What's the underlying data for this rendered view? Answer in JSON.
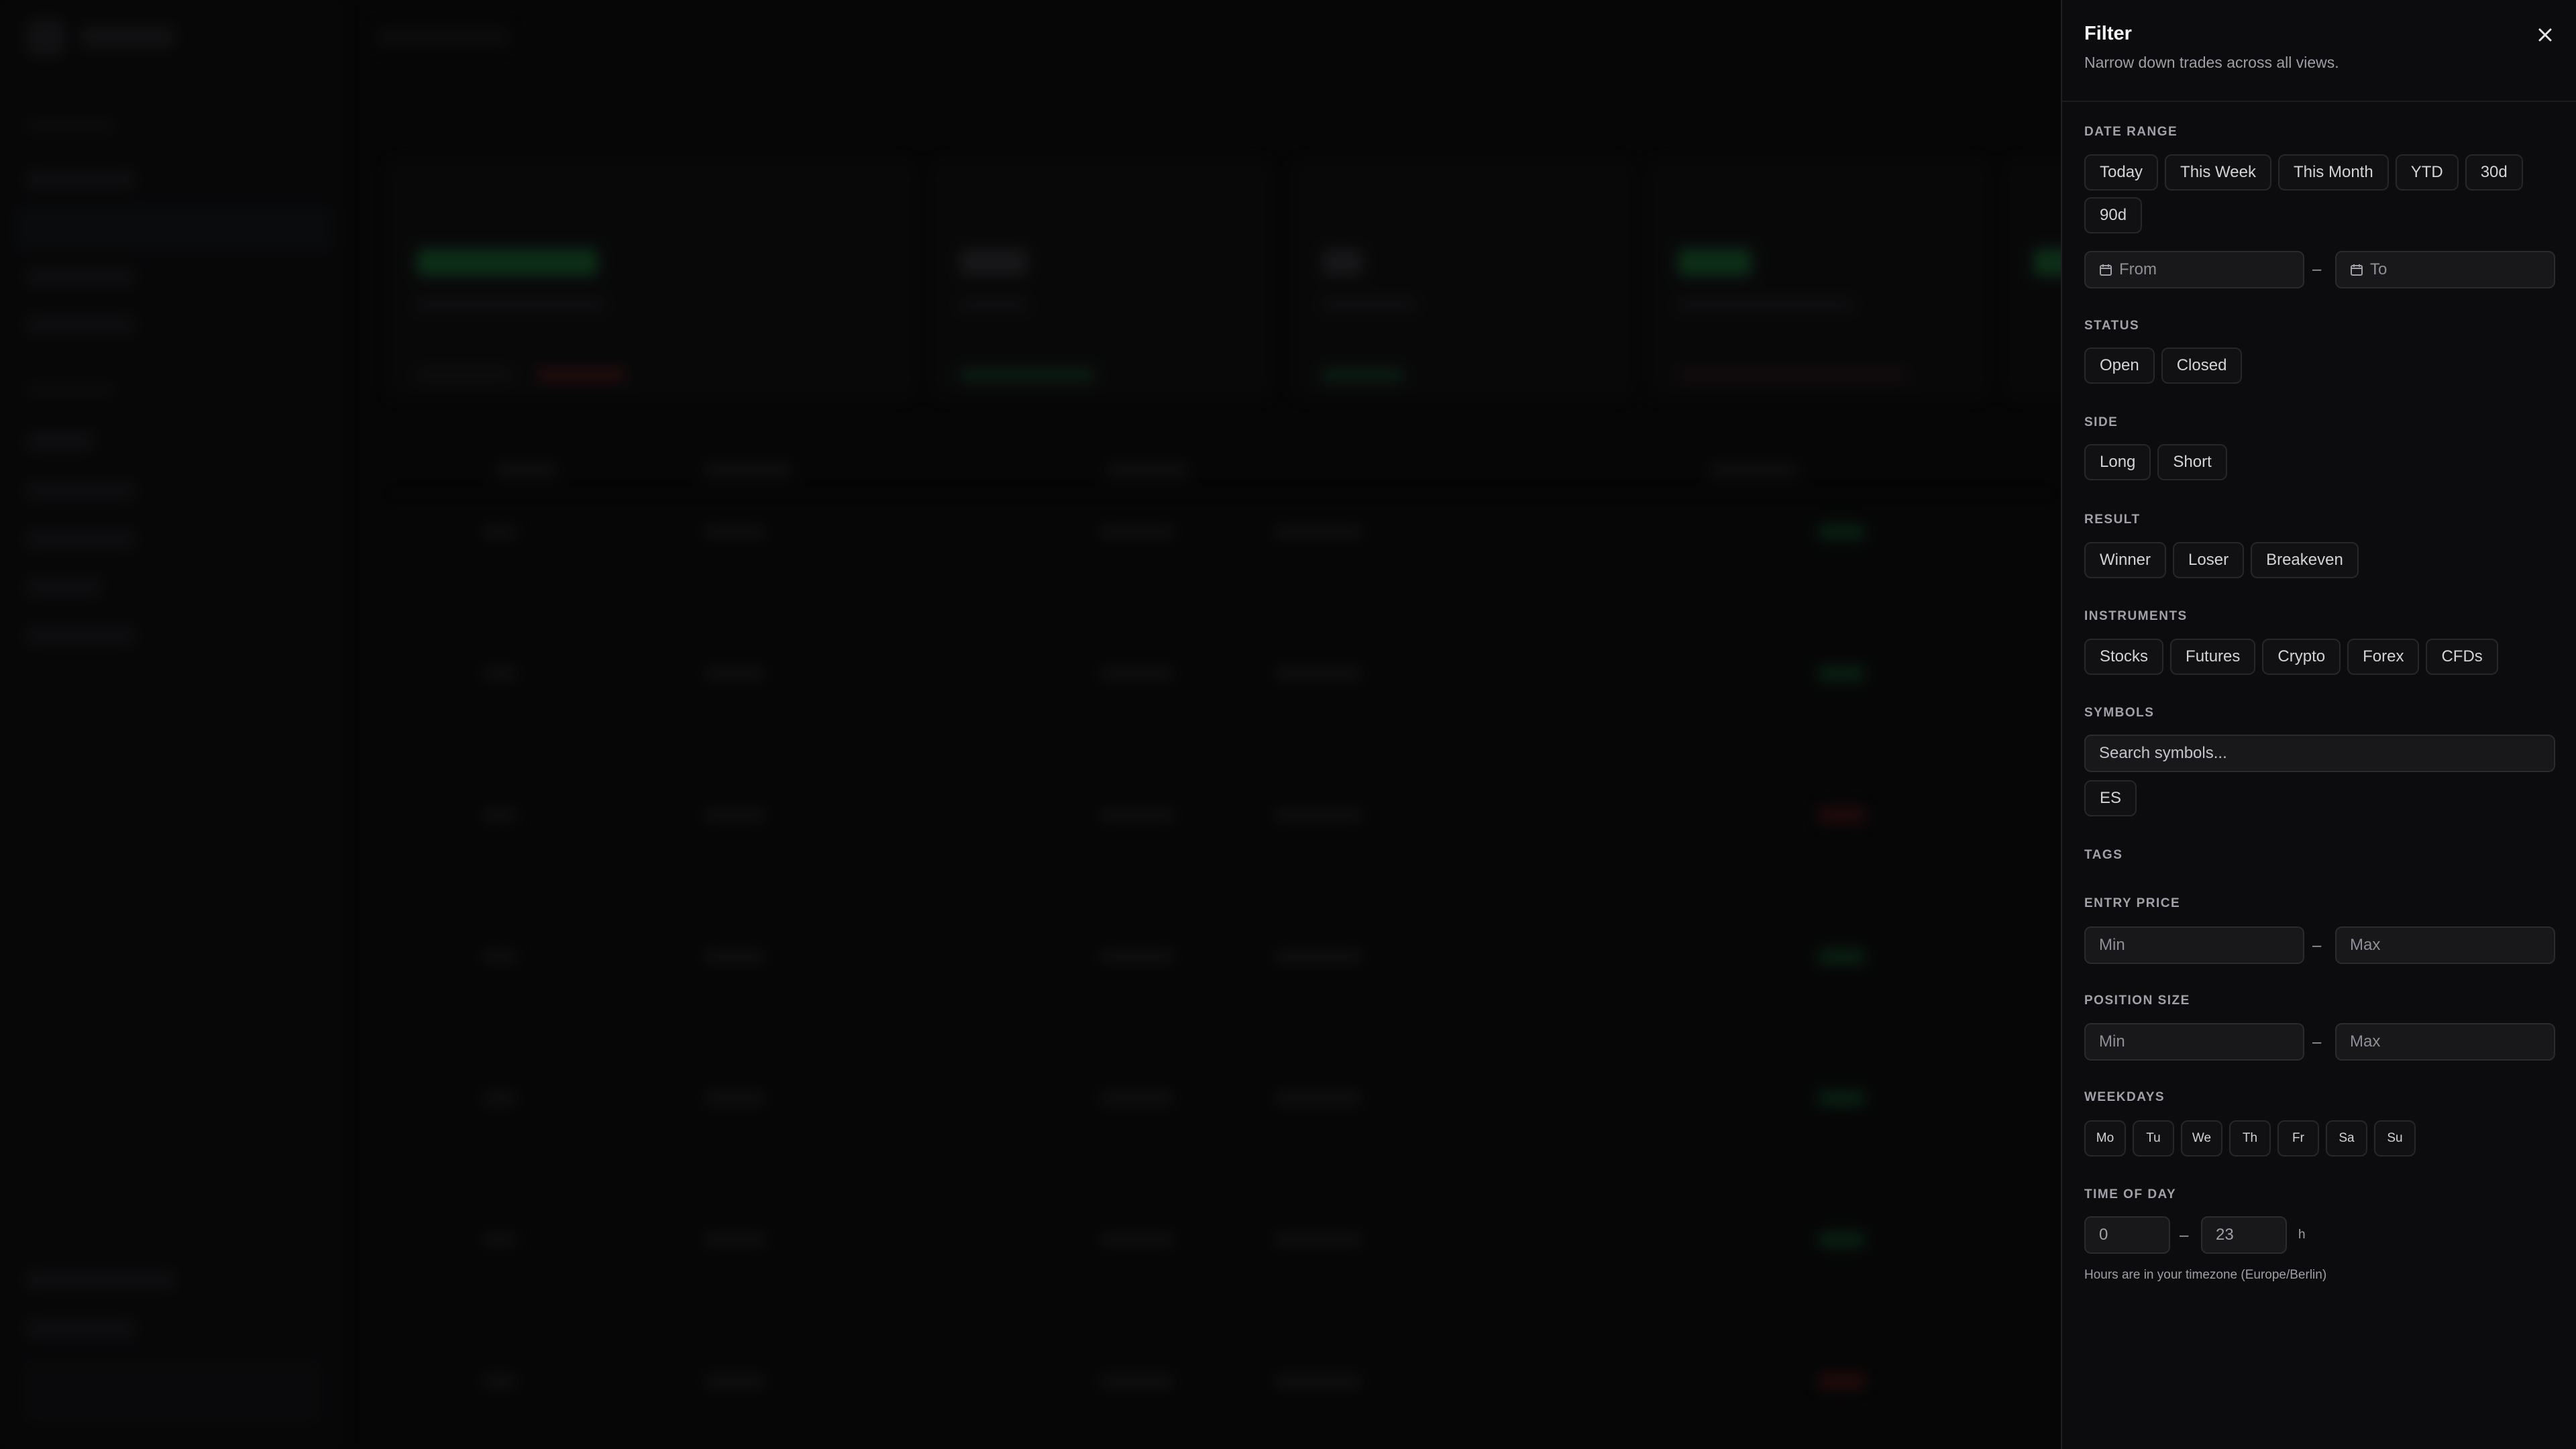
{
  "filter": {
    "title": "Filter",
    "subtitle": "Narrow down trades across all views.",
    "date_range": {
      "label": "DATE RANGE",
      "presets": [
        "Today",
        "This Week",
        "This Month",
        "YTD",
        "30d",
        "90d"
      ],
      "from_placeholder": "From",
      "to_placeholder": "To",
      "separator": "–"
    },
    "status": {
      "label": "STATUS",
      "options": [
        "Open",
        "Closed"
      ]
    },
    "side": {
      "label": "SIDE",
      "options": [
        "Long",
        "Short"
      ]
    },
    "result": {
      "label": "RESULT",
      "options": [
        "Winner",
        "Loser",
        "Breakeven"
      ]
    },
    "instruments": {
      "label": "INSTRUMENTS",
      "options": [
        "Stocks",
        "Futures",
        "Crypto",
        "Forex",
        "CFDs"
      ]
    },
    "symbols": {
      "label": "SYMBOLS",
      "placeholder": "Search symbols...",
      "chips": [
        "ES"
      ]
    },
    "tags": {
      "label": "TAGS"
    },
    "entry_price": {
      "label": "ENTRY PRICE",
      "min_placeholder": "Min",
      "max_placeholder": "Max",
      "separator": "–"
    },
    "position_size": {
      "label": "POSITION SIZE",
      "min_placeholder": "Min",
      "max_placeholder": "Max",
      "separator": "–"
    },
    "weekdays": {
      "label": "WEEKDAYS",
      "days": [
        "Mo",
        "Tu",
        "We",
        "Th",
        "Fr",
        "Sa",
        "Su"
      ]
    },
    "time_of_day": {
      "label": "TIME OF DAY",
      "from_value": "0",
      "to_value": "23",
      "separator": "–",
      "unit": "h",
      "hint": "Hours are in your timezone (Europe/Berlin)"
    }
  },
  "icons": {
    "close": "close-icon",
    "calendar": "calendar-icon"
  },
  "colors": {
    "panel_background": "#0c0c0e",
    "chip_border": "#26262b",
    "input_background": "#18181b",
    "profit_green": "#1f9d4a",
    "loss_red": "#b42323"
  }
}
